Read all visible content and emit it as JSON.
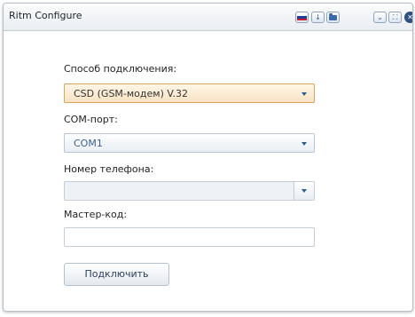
{
  "window": {
    "title": "Ritm Configure",
    "toolbar": {
      "download_icon_glyph": "↓",
      "minimize_glyph": "⌄",
      "maximize_glyph": "⛶",
      "close_glyph": "✕"
    },
    "flag_colors": [
      "#ffffff",
      "#1f3f9e",
      "#d01f2a"
    ]
  },
  "form": {
    "connection": {
      "label": "Способ подключения:",
      "value": "CSD (GSM-модем) V.32"
    },
    "port": {
      "label": "COM-порт:",
      "value": "COM1"
    },
    "phone": {
      "label": "Номер телефона:",
      "value": ""
    },
    "master_code": {
      "label": "Мастер-код:",
      "value": ""
    },
    "connect_button": "Подключить"
  }
}
